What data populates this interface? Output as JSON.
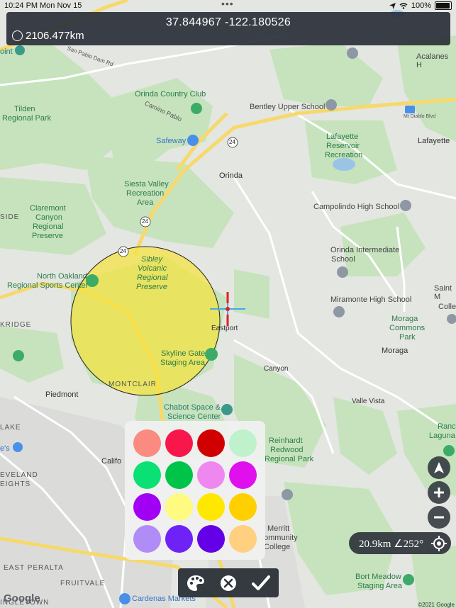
{
  "status_bar": {
    "time": "10:24 PM",
    "date": "Mon Nov 15",
    "battery": "100%"
  },
  "header": {
    "coordinates": "37.844967 -122.180526",
    "radius": "2106.477km"
  },
  "map": {
    "labels": {
      "san_pablo_dam": "San Pablo Dam Rd",
      "orinda_cc": "Orinda Country Club",
      "tilden_1": "Tilden",
      "tilden_2": "Regional Park",
      "camino_pablo": "Camino Pablo",
      "safeway": "Safeway",
      "bentley": "Bentley Upper School",
      "lafayette_res_1": "Lafayette",
      "lafayette_res_2": "Reservoir",
      "lafayette_res_3": "Recreation",
      "lafayette": "Lafayette",
      "acalanes": "Acalanes H",
      "mt_diablo": "Mt Diablo Blvd",
      "orinda": "Orinda",
      "siesta_1": "Siesta Valley",
      "siesta_2": "Recreation",
      "siesta_3": "Area",
      "claremont_1": "Claremont",
      "claremont_2": "Canyon",
      "claremont_3": "Regional",
      "claremont_4": "Preserve",
      "campolindo": "Campolindo High School",
      "orinda_int_1": "Orinda Intermediate",
      "orinda_int_2": "School",
      "sibley_1": "Sibley",
      "sibley_2": "Volcanic",
      "sibley_3": "Regional",
      "sibley_4": "Preserve",
      "north_oakland_1": "North Oakland",
      "north_oakland_2": "Regional Sports Center",
      "miramonte": "Miramonte High School",
      "eastport": "Eastport",
      "moraga_commons_1": "Moraga",
      "moraga_commons_2": "Commons",
      "moraga_commons_3": "Park",
      "moraga": "Moraga",
      "skyline_1": "Skyline Gate",
      "skyline_2": "Staging Area",
      "canyon": "Canyon",
      "montclair": "MONTCLAIR",
      "piedmont": "Piedmont",
      "kridge": "KRIDGE",
      "side": "SIDE",
      "chabot_1": "Chabot Space &",
      "chabot_2": "Science Center",
      "valle_vista": "Valle Vista",
      "reinhardt_1": "Reinhardt",
      "reinhardt_2": "Redwood",
      "reinhardt_3": "Regional Park",
      "lake": "LAKE",
      "leveland": "EVELAND",
      "eights": "EIGHTS",
      "califo": "Califo",
      "merritt_1": "Merritt",
      "merritt_2": "ommunity",
      "merritt_3": "College",
      "east_peralta": "EAST PERALTA",
      "fruitvale": "FRUITVALE",
      "bort_1": "Bort Meadow",
      "bort_2": "Staging Area",
      "cardenas": "Cardenas Markets",
      "ingletown": "INGLETOWN",
      "saint_1": "Saint M",
      "saint_2": "Colle",
      "ranch_1": "Ranch",
      "ranch_2": "Laguna",
      "point": "oint",
      "es": "e's",
      "rd_24": "24"
    }
  },
  "measure_circle": {
    "fill": "#f6e23a",
    "stroke": "#222222"
  },
  "palette": {
    "colors": [
      "#fb8a80",
      "#f8174b",
      "#d10000",
      "#bff2cc",
      "#0be074",
      "#00c44a",
      "#ee88f0",
      "#e010ee",
      "#a100f5",
      "#fffa80",
      "#ffe800",
      "#ffd000",
      "#b08cf6",
      "#6e22f6",
      "#6400e8",
      "#ffd080"
    ]
  },
  "toolbar": {
    "palette": "palette-icon",
    "cancel": "close-circle-icon",
    "confirm": "checkmark-icon"
  },
  "controls": {
    "scale_bearing": "20.9km ∠252°"
  },
  "footer": {
    "google": "Google",
    "copyright": "©2021 Google"
  }
}
